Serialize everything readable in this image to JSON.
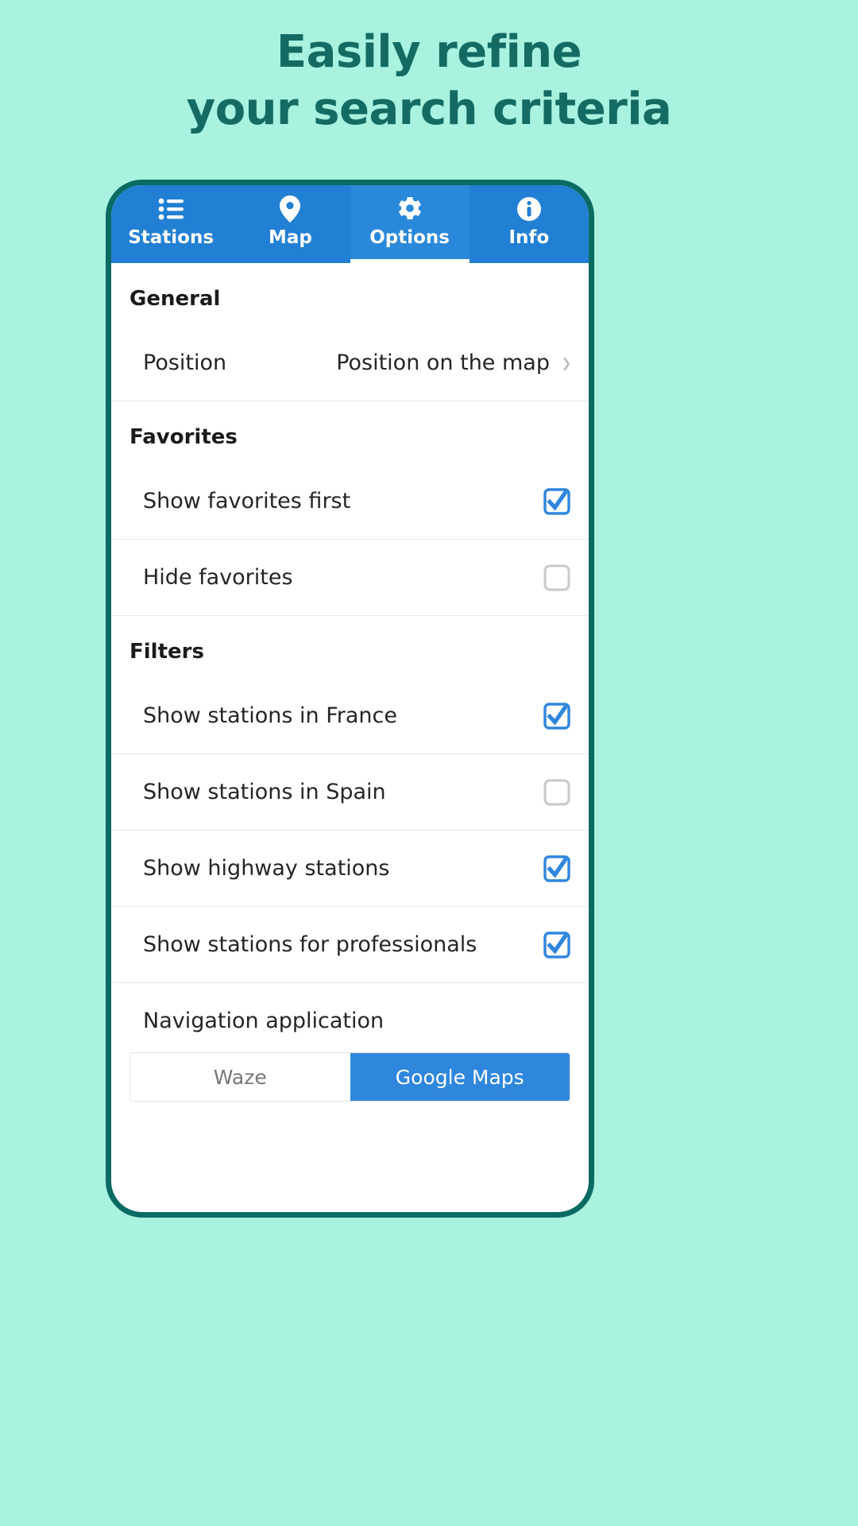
{
  "headline": {
    "line1": "Easily refine",
    "line2": "your search criteria",
    "color": "#136b63"
  },
  "background_color": "#a9f2e0",
  "phone": {
    "frame_color": "#0a6b63",
    "screen_background": "#ffffff"
  },
  "tabbar": {
    "background_color": "#2280d4",
    "active_background_color": "#2a88da",
    "active_index": 2,
    "tabs": [
      {
        "label": "Stations",
        "icon": "list-icon",
        "active": false
      },
      {
        "label": "Map",
        "icon": "map-pin-icon",
        "active": false
      },
      {
        "label": "Options",
        "icon": "gear-icon",
        "active": true
      },
      {
        "label": "Info",
        "icon": "info-circle-icon",
        "active": false
      }
    ]
  },
  "settings": {
    "sections": [
      {
        "header": "General",
        "rows": [
          {
            "label": "Position",
            "value": "Position on the map",
            "control": "chevron",
            "chevron": "›"
          }
        ]
      },
      {
        "header": "Favorites",
        "rows": [
          {
            "label": "Show favorites first",
            "control": "checkbox",
            "checked": true
          },
          {
            "label": "Hide favorites",
            "control": "checkbox",
            "checked": false
          }
        ]
      },
      {
        "header": "Filters",
        "rows": [
          {
            "label": "Show stations in France",
            "control": "checkbox",
            "checked": true
          },
          {
            "label": "Show stations in Spain",
            "control": "checkbox",
            "checked": false
          },
          {
            "label": "Show highway stations",
            "control": "checkbox",
            "checked": true
          },
          {
            "label": "Show stations for professionals",
            "control": "checkbox",
            "checked": true
          }
        ]
      }
    ],
    "navigation_application": {
      "label": "Navigation application",
      "options": [
        {
          "label": "Waze",
          "selected": false
        },
        {
          "label": "Google Maps",
          "selected": true
        }
      ]
    }
  },
  "colors": {
    "accent_blue": "#2f86dd",
    "checkbox_checked": "#2f86dd",
    "checkbox_unchecked_border": "#c9c9c9",
    "row_divider": "#e8e8e8",
    "text_primary": "#252525"
  }
}
